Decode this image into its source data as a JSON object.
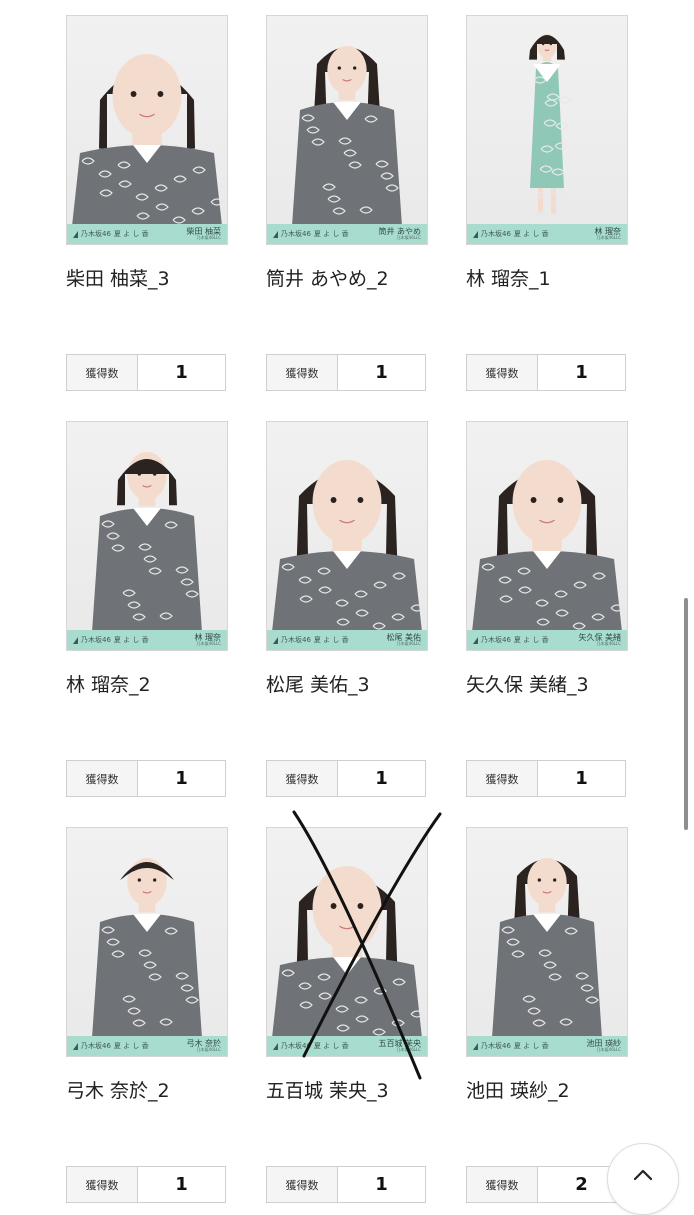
{
  "cards": [
    {
      "name": "柴田 柚菜_3",
      "count_label": "獲得数",
      "count": "1",
      "band_brand": "乃木坂46",
      "band_title": "夏 よ し 香",
      "band_name": "柴田 柚菜",
      "band_sub": "乃木坂46LLC",
      "pose": "closeup",
      "hair": "short"
    },
    {
      "name": "筒井 あやめ_2",
      "count_label": "獲得数",
      "count": "1",
      "band_brand": "乃木坂46",
      "band_title": "夏 よ し 香",
      "band_name": "筒井 あやめ",
      "band_sub": "乃木坂46LLC",
      "pose": "halfbody",
      "hair": "long"
    },
    {
      "name": "林 瑠奈_1",
      "count_label": "獲得数",
      "count": "1",
      "band_brand": "乃木坂46",
      "band_title": "夏 よ し 香",
      "band_name": "林 瑠奈",
      "band_sub": "乃木坂46LLC",
      "pose": "fullbody",
      "hair": "short"
    },
    {
      "name": "林 瑠奈_2",
      "count_label": "獲得数",
      "count": "1",
      "band_brand": "乃木坂46",
      "band_title": "夏 よ し 香",
      "band_name": "林 瑠奈",
      "band_sub": "乃木坂46LLC",
      "pose": "halfbody",
      "hair": "short"
    },
    {
      "name": "松尾 美佑_3",
      "count_label": "獲得数",
      "count": "1",
      "band_brand": "乃木坂46",
      "band_title": "夏 よ し 香",
      "band_name": "松尾 美佑",
      "band_sub": "乃木坂46LLC",
      "pose": "closeup",
      "hair": "long"
    },
    {
      "name": "矢久保 美緒_3",
      "count_label": "獲得数",
      "count": "1",
      "band_brand": "乃木坂46",
      "band_title": "夏 よ し 香",
      "band_name": "矢久保 美緒",
      "band_sub": "乃木坂46LLC",
      "pose": "closeup",
      "hair": "long"
    },
    {
      "name": "弓木 奈於_2",
      "count_label": "獲得数",
      "count": "1",
      "band_brand": "乃木坂46",
      "band_title": "夏 よ し 香",
      "band_name": "弓木 奈於",
      "band_sub": "乃木坂46LLC",
      "pose": "halfbody",
      "hair": "tied"
    },
    {
      "name": "五百城 茉央_3",
      "count_label": "獲得数",
      "count": "1",
      "band_brand": "乃木坂46",
      "band_title": "夏 よ し 香",
      "band_name": "五百城 茉央",
      "band_sub": "乃木坂46LLC",
      "pose": "closeup",
      "hair": "long"
    },
    {
      "name": "池田 瑛紗_2",
      "count_label": "獲得数",
      "count": "2",
      "band_brand": "乃木坂46",
      "band_title": "夏 よ し 香",
      "band_name": "池田 瑛紗",
      "band_sub": "乃木坂46LLC",
      "pose": "halfbody",
      "hair": "twin"
    }
  ],
  "colors": {
    "band": "#a8dccf",
    "hair": "#2a2320",
    "skin": "#f3dccd",
    "dress": "#6f7377",
    "collar": "#ffffff"
  },
  "icons": {
    "scroll_top": "chevron-up-icon",
    "band_logo": "triangle-logo-icon"
  }
}
